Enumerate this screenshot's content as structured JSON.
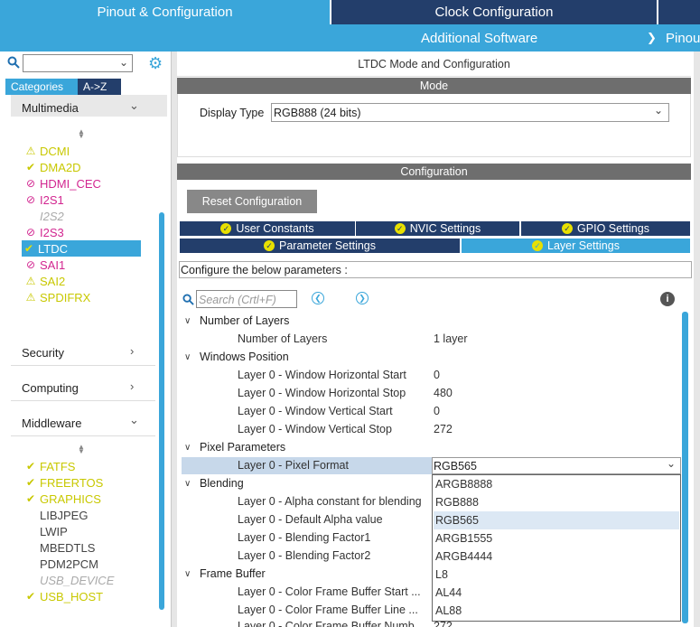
{
  "top_tabs": [
    "Pinout & Configuration",
    "Clock Configuration"
  ],
  "sub_tabs": [
    "Additional Software",
    "Pinou"
  ],
  "left": {
    "search_value": "",
    "cat_tabs": [
      "Categories",
      "A->Z"
    ],
    "multimedia": "Multimedia",
    "items": [
      {
        "label": "DCMI",
        "status": "warn"
      },
      {
        "label": "DMA2D",
        "status": "ok"
      },
      {
        "label": "HDMI_CEC",
        "status": "no"
      },
      {
        "label": "I2S1",
        "status": "no"
      },
      {
        "label": "I2S2",
        "status": "disabled"
      },
      {
        "label": "I2S3",
        "status": "no"
      },
      {
        "label": "LTDC",
        "status": "selected"
      },
      {
        "label": "SAI1",
        "status": "no"
      },
      {
        "label": "SAI2",
        "status": "warn"
      },
      {
        "label": "SPDIFRX",
        "status": "warn"
      }
    ],
    "security": "Security",
    "computing": "Computing",
    "middleware": "Middleware",
    "mw_items": [
      {
        "label": "FATFS",
        "status": "ok"
      },
      {
        "label": "FREERTOS",
        "status": "ok"
      },
      {
        "label": "GRAPHICS",
        "status": "ok"
      },
      {
        "label": "LIBJPEG",
        "status": "plain"
      },
      {
        "label": "LWIP",
        "status": "plain"
      },
      {
        "label": "MBEDTLS",
        "status": "plain"
      },
      {
        "label": "PDM2PCM",
        "status": "plain"
      },
      {
        "label": "USB_DEVICE",
        "status": "disabled"
      },
      {
        "label": "USB_HOST",
        "status": "ok"
      }
    ]
  },
  "main": {
    "title": "LTDC Mode and Configuration",
    "mode_bar": "Mode",
    "display_type_label": "Display Type",
    "display_type_value": "RGB888 (24 bits)",
    "config_bar": "Configuration",
    "reset_label": "Reset Configuration",
    "tabs_row1": [
      "User Constants",
      "NVIC Settings",
      "GPIO Settings"
    ],
    "tabs_row2": [
      "Parameter Settings",
      "Layer Settings"
    ],
    "configure_text": "Configure the below parameters :",
    "search_placeholder": "Search (Crtl+F)"
  },
  "params": {
    "g1": "Number of Layers",
    "r1": {
      "label": "Number of Layers",
      "value": "1 layer"
    },
    "g2": "Windows Position",
    "r2": {
      "label": "Layer 0 - Window Horizontal Start",
      "value": "0"
    },
    "r3": {
      "label": "Layer 0 - Window Horizontal Stop",
      "value": "480"
    },
    "r4": {
      "label": "Layer 0 - Window Vertical Start",
      "value": "0"
    },
    "r5": {
      "label": "Layer 0 - Window Vertical Stop",
      "value": "272"
    },
    "g3": "Pixel Parameters",
    "r6": {
      "label": "Layer 0 - Pixel Format",
      "value": "RGB565"
    },
    "g4": "Blending",
    "r7": {
      "label": "Layer 0 - Alpha constant for blending"
    },
    "r8": {
      "label": "Layer 0 - Default Alpha value"
    },
    "r9": {
      "label": "Layer 0 - Blending Factor1"
    },
    "r10": {
      "label": "Layer 0 - Blending Factor2"
    },
    "g5": "Frame Buffer",
    "r11": {
      "label": "Layer 0 - Color Frame Buffer Start ..."
    },
    "r12": {
      "label": "Layer 0 - Color Frame Buffer Line ..."
    },
    "r13": {
      "label": "Layer 0 - Color Frame Buffer Numb...",
      "value": "272"
    }
  },
  "dropdown_options": [
    "ARGB8888",
    "RGB888",
    "RGB565",
    "ARGB1555",
    "ARGB4444",
    "L8",
    "AL44",
    "AL88"
  ],
  "dropdown_selected": "RGB565",
  "colors": {
    "accent": "#3aa6da",
    "navy": "#233e6b",
    "bar": "#6e6e6e",
    "warn": "#c8c800",
    "error": "#d22690"
  }
}
